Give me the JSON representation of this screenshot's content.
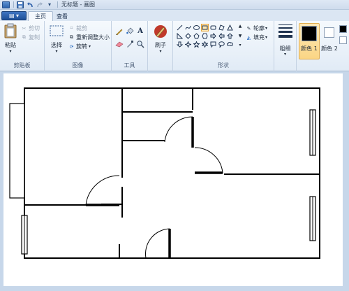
{
  "window": {
    "title": "无标题 - 画图"
  },
  "quick_access": {
    "save_icon": "save-icon",
    "undo_icon": "undo-icon",
    "redo_icon": "redo-icon",
    "customize_icon": "dropdown-icon"
  },
  "app_menu": {
    "label": "▤ ▾"
  },
  "tabs": [
    {
      "label": "主页",
      "active": true
    },
    {
      "label": "查看",
      "active": false
    }
  ],
  "ribbon": {
    "clipboard": {
      "label": "剪贴板",
      "paste": "粘贴",
      "cut": "剪切",
      "copy": "复制"
    },
    "image": {
      "label": "图像",
      "select": "选择",
      "crop": "裁剪",
      "resize": "重新调整大小",
      "rotate": "旋转"
    },
    "tools": {
      "label": "工具"
    },
    "brushes": {
      "label": "刷子"
    },
    "shapes": {
      "label": "形状",
      "outline": "轮廓",
      "fill": "填充"
    },
    "size": {
      "label": "粗细"
    },
    "colors": {
      "color1": "颜色 1",
      "color2": "颜色 2",
      "color1_value": "#000000",
      "color2_value": "#ffffff",
      "accent": "#fbd585"
    }
  },
  "canvas": {
    "background": "#ffffff",
    "wall_color": "#000000"
  }
}
